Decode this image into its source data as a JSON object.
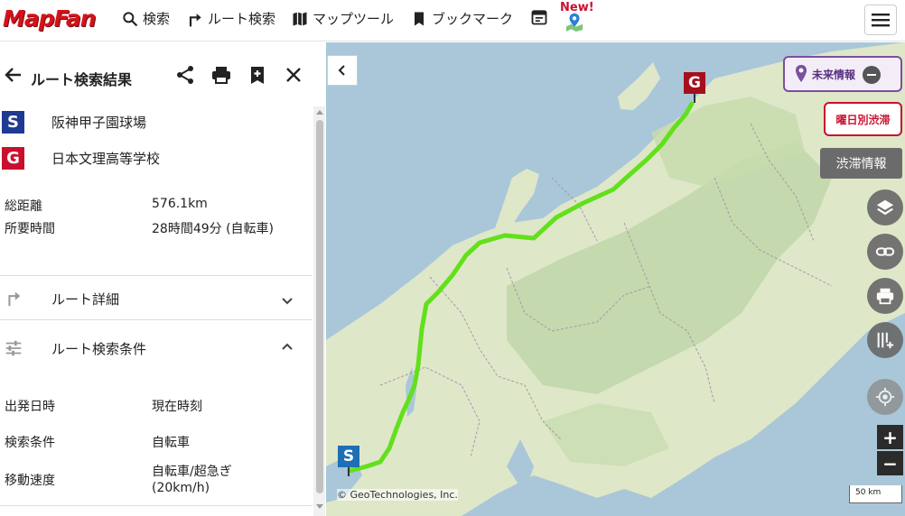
{
  "header": {
    "logo": "MapFan",
    "nav": [
      {
        "label": "検索",
        "icon": "search-icon"
      },
      {
        "label": "ルート検索",
        "icon": "route-turn-icon"
      },
      {
        "label": "マップツール",
        "icon": "map-icon"
      },
      {
        "label": "ブックマーク",
        "icon": "bookmark-icon"
      }
    ],
    "calendar_icon": "calendar-icon",
    "new_badge": "New!",
    "menu_icon": "hamburger-menu-icon"
  },
  "panel": {
    "title": "ルート検索結果",
    "start": {
      "badge": "S",
      "name": "阪神甲子園球場",
      "color": "#1f3a93"
    },
    "goal": {
      "badge": "G",
      "name": "日本文理高等学校",
      "color": "#c8102e"
    },
    "summary": [
      {
        "key": "総距離",
        "value": "576.1km"
      },
      {
        "key": "所要時間",
        "value": "28時間49分 (自転車)"
      }
    ],
    "sections": {
      "route_detail": "ルート詳細",
      "route_conditions": "ルート検索条件"
    },
    "conditions": [
      {
        "key": "出発日時",
        "value": "現在時刻"
      },
      {
        "key": "検索条件",
        "value": "自転車"
      },
      {
        "key": "移動速度",
        "value": "自転車/超急ぎ",
        "value2": "(20km/h)"
      }
    ]
  },
  "map": {
    "future_info": "未来情報",
    "weekday_traffic": "曜日別渋滞",
    "traffic_info": "渋滞情報",
    "copyright": "© GeoTechnologies, Inc.",
    "scale": "50 km",
    "start_marker": "S",
    "goal_marker": "G",
    "route_color": "#62e01c",
    "zoom_in": "+",
    "zoom_out": "−"
  }
}
